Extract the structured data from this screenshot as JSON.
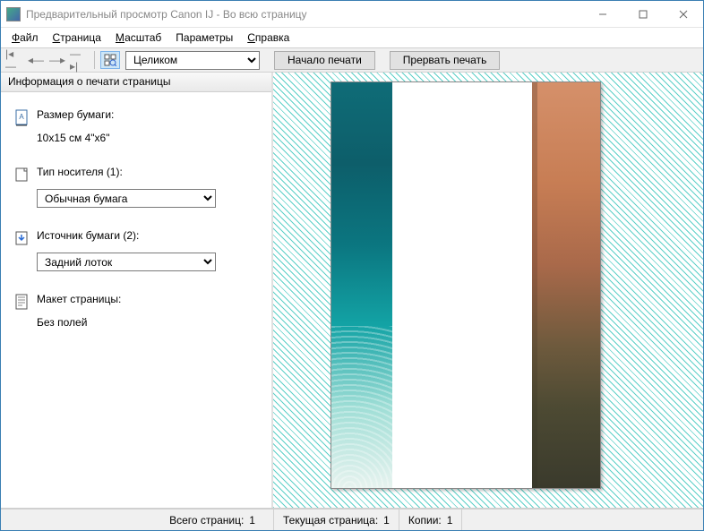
{
  "window": {
    "title": "Предварительный просмотр Canon IJ - Во всю страницу"
  },
  "menu": {
    "file": "Файл",
    "page": "Страница",
    "zoom": "Масштаб",
    "options": "Параметры",
    "help": "Справка"
  },
  "toolbar": {
    "zoom_selected": "Целиком",
    "start_print": "Начало печати",
    "cancel_print": "Прервать печать"
  },
  "sidebar": {
    "header": "Информация о печати страницы",
    "paper_size_label": "Размер бумаги:",
    "paper_size_value": "10x15 см 4\"x6\"",
    "media_type_label": "Тип носителя (1):",
    "media_type_value": "Обычная бумага",
    "paper_source_label": "Источник бумаги (2):",
    "paper_source_value": "Задний лоток",
    "page_layout_label": "Макет страницы:",
    "page_layout_value": "Без полей"
  },
  "status": {
    "total_label": "Всего страниц:",
    "total_value": "1",
    "current_label": "Текущая страница:",
    "current_value": "1",
    "copies_label": "Копии:",
    "copies_value": "1"
  }
}
